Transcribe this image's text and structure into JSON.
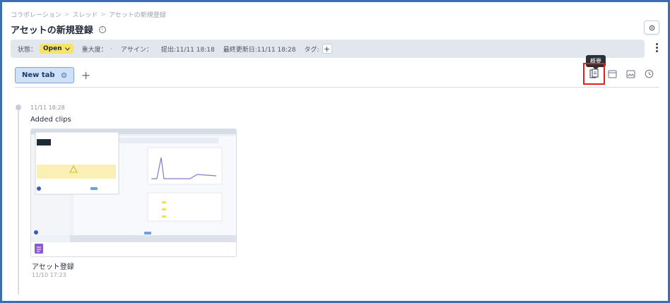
{
  "breadcrumb": {
    "items": [
      "コラボレーション",
      "スレッド",
      "アセットの新規登録"
    ],
    "separator": ">"
  },
  "page": {
    "title": "アセットの新規登録"
  },
  "meta": {
    "status_label": "状態：",
    "status_value": "Open",
    "severity_label": "重大度：",
    "severity_value": "-",
    "assignee_label": "アサイン：",
    "submitted": "提出:11/11 18:18",
    "last_updated": "最終更新日:11/11 18:28",
    "tag_label": "タグ:",
    "tag_add": "+"
  },
  "tabs": {
    "items": [
      {
        "label": "New tab"
      }
    ],
    "add": "+"
  },
  "toolbar": {
    "tooltip": "概要"
  },
  "timeline": {
    "entry_time": "11/11 18:28",
    "entry_title": "Added clips",
    "clip": {
      "name": "アセット登録",
      "date": "11/10 17:23"
    }
  },
  "colors": {
    "frame": "#3b6eb4",
    "status_pill": "#f7e36a",
    "tab_active_bg": "#cfe1f8",
    "highlight": "#e02020"
  }
}
